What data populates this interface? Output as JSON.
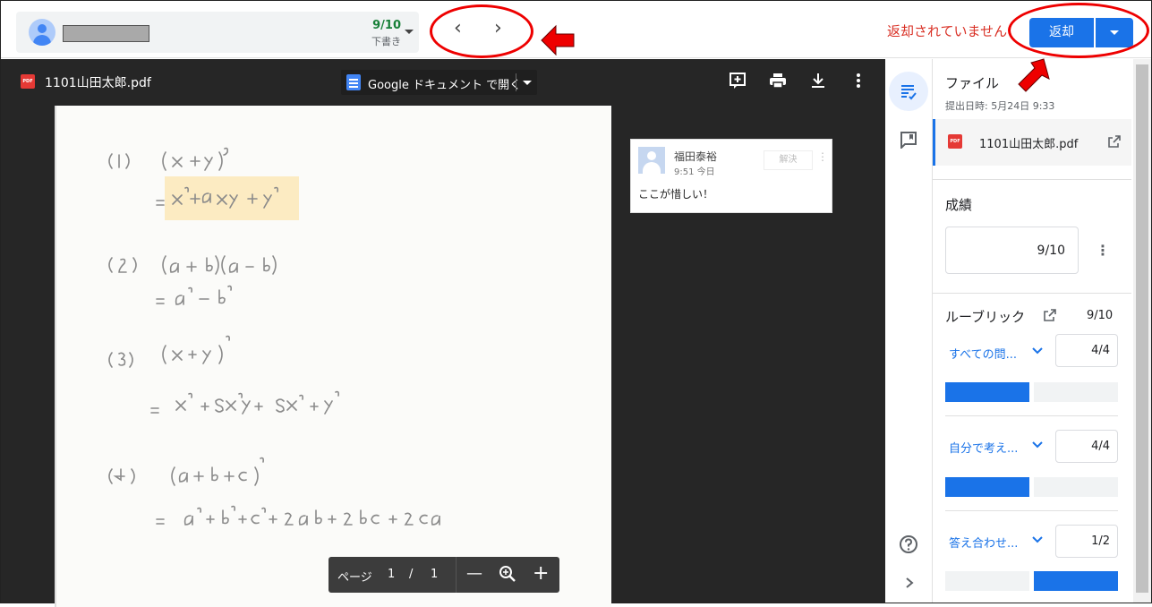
{
  "header": {
    "score": "9/10",
    "draft_label": "下書き",
    "status_text": "返却されていません",
    "return_label": "返却"
  },
  "viewer": {
    "file_name": "1101山田太郎.pdf",
    "pdf_badge": "PDF",
    "open_in_docs_label": "Google ドキュメント で開く",
    "page_label": "ページ",
    "current_page": "1",
    "page_sep": "/",
    "total_pages": "1"
  },
  "comment": {
    "author": "福田泰裕",
    "time": "9:51 今日",
    "resolve_label": "解決",
    "text": "ここが惜しい！"
  },
  "panel": {
    "file_section_title": "ファイル",
    "submitted_at": "提出日時: 5月24日 9:33",
    "attached_file": "1101山田太郎.pdf",
    "grade_title": "成績",
    "grade_value": "9/10",
    "rubric_title": "ルーブリック",
    "rubric_total": "9/10",
    "criteria": [
      {
        "label": "すべての問...",
        "score": "4/4",
        "level_fraction": 0.5
      },
      {
        "label": "自分で考え...",
        "score": "4/4",
        "level_fraction": 0.5
      },
      {
        "label": "答え合わせ...",
        "score": "1/2",
        "level_fraction": 0.5
      }
    ]
  },
  "colors": {
    "accent": "#1a73e8",
    "status_red": "#d93025",
    "score_green": "#188038",
    "annotation_red": "#e00000"
  }
}
